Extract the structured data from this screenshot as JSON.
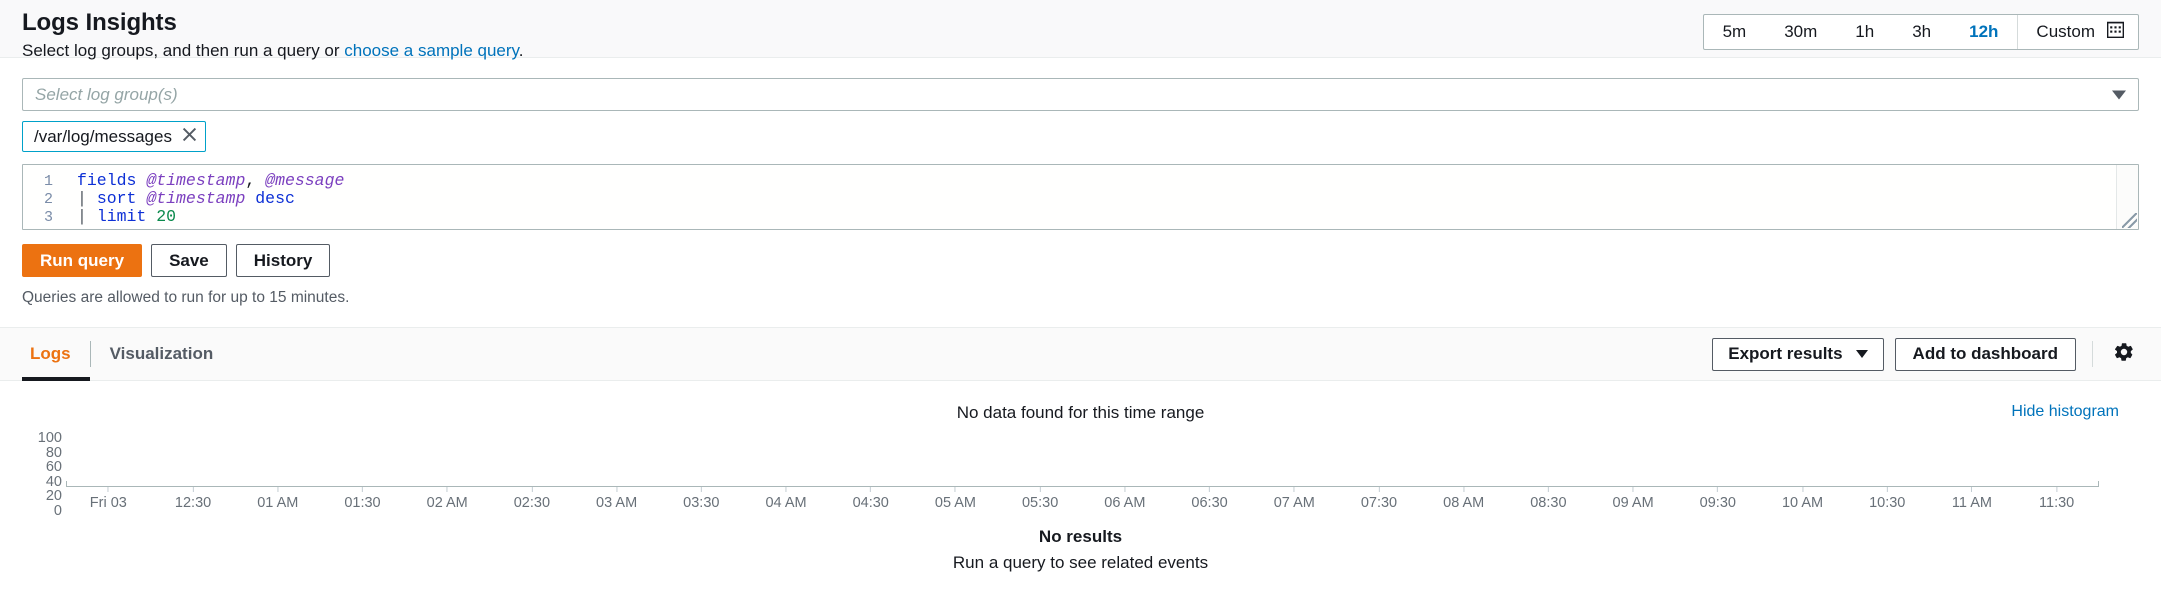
{
  "header": {
    "title": "Logs Insights",
    "subtitle_prefix": "Select log groups, and then run a query or ",
    "subtitle_link": "choose a sample query",
    "subtitle_suffix": "."
  },
  "time_range": {
    "options": [
      "5m",
      "30m",
      "1h",
      "3h",
      "12h"
    ],
    "selected": "12h",
    "custom_label": "Custom",
    "calendar_icon": "calendar-icon"
  },
  "log_group_select": {
    "placeholder": "Select log group(s)",
    "caret_icon": "chevron-down-icon",
    "selected_tokens": [
      {
        "label": "/var/log/messages",
        "remove_icon": "close-icon"
      }
    ]
  },
  "query_editor": {
    "lines": [
      {
        "number": "1",
        "tokens": [
          {
            "text": "fields",
            "type": "kw"
          },
          {
            "text": " ",
            "type": "plain"
          },
          {
            "text": "@timestamp",
            "type": "fld"
          },
          {
            "text": ", ",
            "type": "plain"
          },
          {
            "text": "@message",
            "type": "fld"
          }
        ]
      },
      {
        "number": "2",
        "tokens": [
          {
            "text": "| ",
            "type": "pipe"
          },
          {
            "text": "sort",
            "type": "kw"
          },
          {
            "text": " ",
            "type": "plain"
          },
          {
            "text": "@timestamp",
            "type": "fld"
          },
          {
            "text": " ",
            "type": "plain"
          },
          {
            "text": "desc",
            "type": "kw"
          }
        ]
      },
      {
        "number": "3",
        "tokens": [
          {
            "text": "| ",
            "type": "pipe"
          },
          {
            "text": "limit",
            "type": "kw"
          },
          {
            "text": " ",
            "type": "plain"
          },
          {
            "text": "20",
            "type": "num"
          }
        ]
      }
    ],
    "resize_handle": "resize-grip"
  },
  "actions": {
    "run_query": "Run query",
    "save": "Save",
    "history": "History",
    "hint": "Queries are allowed to run for up to 15 minutes."
  },
  "tabs": [
    {
      "label": "Logs",
      "active": true
    },
    {
      "label": "Visualization",
      "active": false
    }
  ],
  "tab_actions": {
    "export_results": "Export results",
    "export_caret": "chevron-down-icon",
    "add_to_dashboard": "Add to dashboard",
    "settings_icon": "gear-icon"
  },
  "results": {
    "histogram_message": "No data found for this time range",
    "hide_histogram": "Hide histogram",
    "no_results_title": "No results",
    "no_results_subtitle": "Run a query to see related events"
  },
  "colors": {
    "accent_orange": "#ec7211",
    "link_blue": "#0073bb",
    "token_border": "#00a1c9",
    "axis_gray": "#687078"
  },
  "chart_data": {
    "type": "bar",
    "title": "No data found for this time range",
    "xlabel": "",
    "ylabel": "",
    "ylim": [
      0,
      100
    ],
    "yticks": [
      100,
      80,
      60,
      40,
      20,
      0
    ],
    "grid": false,
    "legend": "none",
    "categories": [
      "Fri 03",
      "12:30",
      "01 AM",
      "01:30",
      "02 AM",
      "02:30",
      "03 AM",
      "03:30",
      "04 AM",
      "04:30",
      "05 AM",
      "05:30",
      "06 AM",
      "06:30",
      "07 AM",
      "07:30",
      "08 AM",
      "08:30",
      "09 AM",
      "09:30",
      "10 AM",
      "10:30",
      "11 AM",
      "11:30"
    ],
    "values": [
      0,
      0,
      0,
      0,
      0,
      0,
      0,
      0,
      0,
      0,
      0,
      0,
      0,
      0,
      0,
      0,
      0,
      0,
      0,
      0,
      0,
      0,
      0,
      0
    ]
  }
}
